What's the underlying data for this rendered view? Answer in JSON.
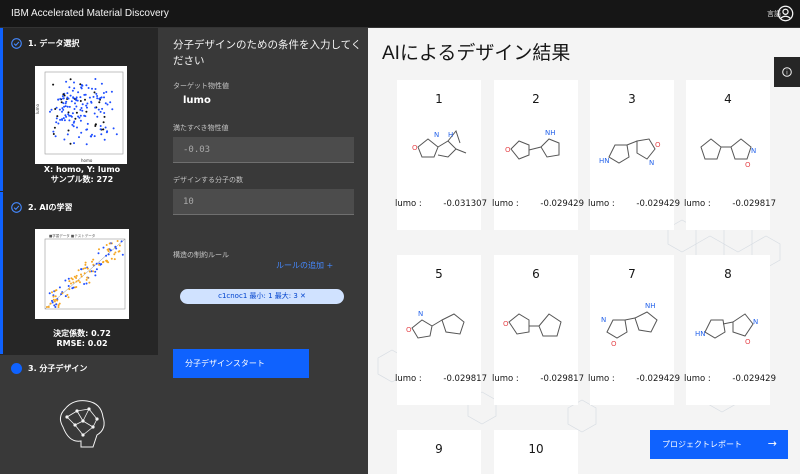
{
  "app": {
    "title": "IBM Accelerated Material Discovery",
    "language_label": "言語"
  },
  "steps": [
    {
      "title": "1. データ選択",
      "caption_line1": "X: homo, Y: lumo",
      "caption_line2": "サンプル数: 272",
      "thumb_ylabel": "lumo",
      "thumb_xlabel": "homo"
    },
    {
      "title": "2. AIの学習",
      "caption_line1": "決定係数: 0.72",
      "caption_line2": "RMSE: 0.02",
      "thumb_legend": "■学習データ ■テストデータ"
    },
    {
      "title": "3. 分子デザイン"
    }
  ],
  "form": {
    "title": "分子デザインのための条件を入力してください",
    "target_label": "ターゲット物性値",
    "target_value": "lumo",
    "satisfy_label": "満たすべき物性値",
    "satisfy_value": "-0.03",
    "count_label": "デザインする分子の数",
    "count_value": "10",
    "rule_label": "構造の制約ルール",
    "add_rule_label": "ルールの追加  +",
    "rule_tag": "c1cnoc1 最小: 1 最大: 3  ✕",
    "start_button": "分子デザインスタート"
  },
  "results": {
    "title": "AIによるデザイン結果",
    "property_label": "lumo :",
    "cards": [
      {
        "num": "1",
        "value": "-0.031307"
      },
      {
        "num": "2",
        "value": "-0.029429"
      },
      {
        "num": "3",
        "value": "-0.029429"
      },
      {
        "num": "4",
        "value": "-0.029817"
      },
      {
        "num": "5",
        "value": "-0.029817"
      },
      {
        "num": "6",
        "value": "-0.029817"
      },
      {
        "num": "7",
        "value": "-0.029429"
      },
      {
        "num": "8",
        "value": "-0.029429"
      },
      {
        "num": "9"
      },
      {
        "num": "10"
      }
    ],
    "report_button": "プロジェクトレポート",
    "report_arrow": "→",
    "info_icon": "i"
  },
  "atoms": {
    "o": "O",
    "n": "N",
    "nh": "NH",
    "hn": "HN",
    "h": "H"
  },
  "colors": {
    "accent": "#0f62fe",
    "n_atom": "#2563eb",
    "o_atom": "#e5484d"
  }
}
